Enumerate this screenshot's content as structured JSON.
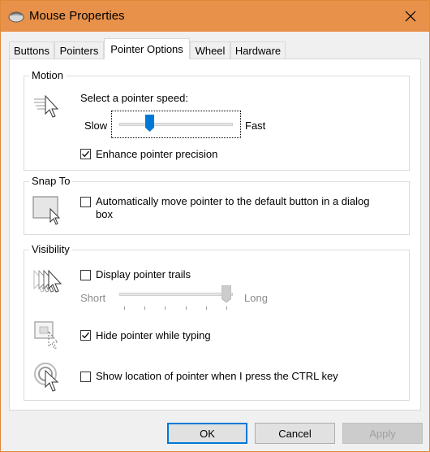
{
  "window": {
    "title": "Mouse Properties"
  },
  "tabs": [
    {
      "label": "Buttons"
    },
    {
      "label": "Pointers"
    },
    {
      "label": "Pointer Options"
    },
    {
      "label": "Wheel"
    },
    {
      "label": "Hardware"
    }
  ],
  "active_tab": "Pointer Options",
  "motion": {
    "title": "Motion",
    "speed_label": "Select a pointer speed:",
    "slow_label": "Slow",
    "fast_label": "Fast",
    "speed_level": 0.25,
    "precision_label": "Enhance pointer precision",
    "precision_checked": true
  },
  "snap_to": {
    "title": "Snap To",
    "label_line1": "Automatically move pointer to the default button in a dialog",
    "label_line2": "box",
    "checked": false
  },
  "visibility": {
    "title": "Visibility",
    "trails_label": "Display pointer trails",
    "trails_checked": false,
    "short_label": "Short",
    "long_label": "Long",
    "trails_level": 1.0,
    "hide_label": "Hide pointer while typing",
    "hide_checked": true,
    "ctrl_label": "Show location of pointer when I press the CTRL key",
    "ctrl_checked": false
  },
  "buttons": {
    "ok": "OK",
    "cancel": "Cancel",
    "apply": "Apply"
  },
  "colors": {
    "titlebar": "#e8914a",
    "accent": "#0078d7"
  }
}
